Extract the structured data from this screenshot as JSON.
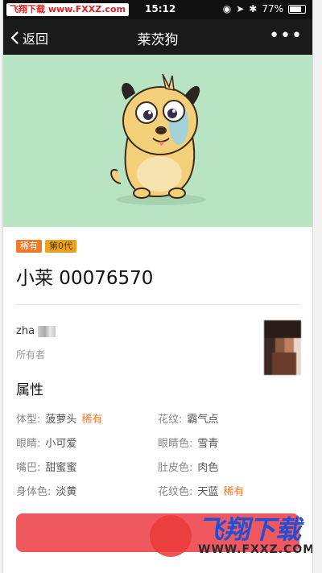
{
  "statusbar": {
    "watermark": "飞翔下载 www.FXXZ.com",
    "time": "15:12",
    "battery": "77%"
  },
  "navbar": {
    "back_label": "返回",
    "title": "莱茨狗",
    "more": "•••"
  },
  "tags": {
    "rare": "稀有",
    "generation": "第0代"
  },
  "pet_name": "小莱 00076570",
  "owner": {
    "name": "zha",
    "label": "所有者"
  },
  "attributes": {
    "title": "属性",
    "rows": [
      [
        {
          "key": "体型:",
          "value": "菠萝头",
          "rare": "稀有"
        },
        {
          "key": "花纹:",
          "value": "霸气点",
          "rare": ""
        }
      ],
      [
        {
          "key": "眼睛:",
          "value": "小可爱",
          "rare": ""
        },
        {
          "key": "眼睛色:",
          "value": "雪青",
          "rare": ""
        }
      ],
      [
        {
          "key": "嘴巴:",
          "value": "甜蜜蜜",
          "rare": ""
        },
        {
          "key": "肚皮色:",
          "value": "肉色",
          "rare": ""
        }
      ],
      [
        {
          "key": "身体色:",
          "value": "淡黄",
          "rare": ""
        },
        {
          "key": "花纹色:",
          "value": "天蓝",
          "rare": "稀有"
        }
      ]
    ]
  },
  "footer_watermark": {
    "brand": "飞翔下载",
    "url": "WWW.FXXZ.COM"
  },
  "colors": {
    "hero_bg": "#b9e4c3",
    "rare": "#f07a2a",
    "button": "#f0585f"
  }
}
